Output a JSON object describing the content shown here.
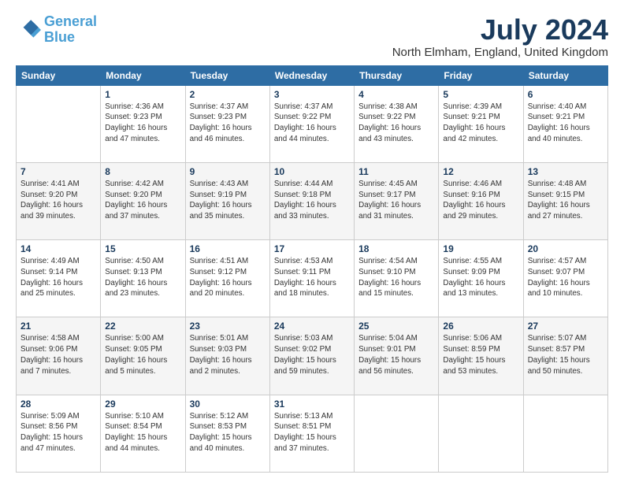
{
  "logo": {
    "line1": "General",
    "line2": "Blue"
  },
  "title": "July 2024",
  "subtitle": "North Elmham, England, United Kingdom",
  "headers": [
    "Sunday",
    "Monday",
    "Tuesday",
    "Wednesday",
    "Thursday",
    "Friday",
    "Saturday"
  ],
  "weeks": [
    [
      {
        "day": "",
        "info": ""
      },
      {
        "day": "1",
        "info": "Sunrise: 4:36 AM\nSunset: 9:23 PM\nDaylight: 16 hours\nand 47 minutes."
      },
      {
        "day": "2",
        "info": "Sunrise: 4:37 AM\nSunset: 9:23 PM\nDaylight: 16 hours\nand 46 minutes."
      },
      {
        "day": "3",
        "info": "Sunrise: 4:37 AM\nSunset: 9:22 PM\nDaylight: 16 hours\nand 44 minutes."
      },
      {
        "day": "4",
        "info": "Sunrise: 4:38 AM\nSunset: 9:22 PM\nDaylight: 16 hours\nand 43 minutes."
      },
      {
        "day": "5",
        "info": "Sunrise: 4:39 AM\nSunset: 9:21 PM\nDaylight: 16 hours\nand 42 minutes."
      },
      {
        "day": "6",
        "info": "Sunrise: 4:40 AM\nSunset: 9:21 PM\nDaylight: 16 hours\nand 40 minutes."
      }
    ],
    [
      {
        "day": "7",
        "info": "Sunrise: 4:41 AM\nSunset: 9:20 PM\nDaylight: 16 hours\nand 39 minutes."
      },
      {
        "day": "8",
        "info": "Sunrise: 4:42 AM\nSunset: 9:20 PM\nDaylight: 16 hours\nand 37 minutes."
      },
      {
        "day": "9",
        "info": "Sunrise: 4:43 AM\nSunset: 9:19 PM\nDaylight: 16 hours\nand 35 minutes."
      },
      {
        "day": "10",
        "info": "Sunrise: 4:44 AM\nSunset: 9:18 PM\nDaylight: 16 hours\nand 33 minutes."
      },
      {
        "day": "11",
        "info": "Sunrise: 4:45 AM\nSunset: 9:17 PM\nDaylight: 16 hours\nand 31 minutes."
      },
      {
        "day": "12",
        "info": "Sunrise: 4:46 AM\nSunset: 9:16 PM\nDaylight: 16 hours\nand 29 minutes."
      },
      {
        "day": "13",
        "info": "Sunrise: 4:48 AM\nSunset: 9:15 PM\nDaylight: 16 hours\nand 27 minutes."
      }
    ],
    [
      {
        "day": "14",
        "info": "Sunrise: 4:49 AM\nSunset: 9:14 PM\nDaylight: 16 hours\nand 25 minutes."
      },
      {
        "day": "15",
        "info": "Sunrise: 4:50 AM\nSunset: 9:13 PM\nDaylight: 16 hours\nand 23 minutes."
      },
      {
        "day": "16",
        "info": "Sunrise: 4:51 AM\nSunset: 9:12 PM\nDaylight: 16 hours\nand 20 minutes."
      },
      {
        "day": "17",
        "info": "Sunrise: 4:53 AM\nSunset: 9:11 PM\nDaylight: 16 hours\nand 18 minutes."
      },
      {
        "day": "18",
        "info": "Sunrise: 4:54 AM\nSunset: 9:10 PM\nDaylight: 16 hours\nand 15 minutes."
      },
      {
        "day": "19",
        "info": "Sunrise: 4:55 AM\nSunset: 9:09 PM\nDaylight: 16 hours\nand 13 minutes."
      },
      {
        "day": "20",
        "info": "Sunrise: 4:57 AM\nSunset: 9:07 PM\nDaylight: 16 hours\nand 10 minutes."
      }
    ],
    [
      {
        "day": "21",
        "info": "Sunrise: 4:58 AM\nSunset: 9:06 PM\nDaylight: 16 hours\nand 7 minutes."
      },
      {
        "day": "22",
        "info": "Sunrise: 5:00 AM\nSunset: 9:05 PM\nDaylight: 16 hours\nand 5 minutes."
      },
      {
        "day": "23",
        "info": "Sunrise: 5:01 AM\nSunset: 9:03 PM\nDaylight: 16 hours\nand 2 minutes."
      },
      {
        "day": "24",
        "info": "Sunrise: 5:03 AM\nSunset: 9:02 PM\nDaylight: 15 hours\nand 59 minutes."
      },
      {
        "day": "25",
        "info": "Sunrise: 5:04 AM\nSunset: 9:01 PM\nDaylight: 15 hours\nand 56 minutes."
      },
      {
        "day": "26",
        "info": "Sunrise: 5:06 AM\nSunset: 8:59 PM\nDaylight: 15 hours\nand 53 minutes."
      },
      {
        "day": "27",
        "info": "Sunrise: 5:07 AM\nSunset: 8:57 PM\nDaylight: 15 hours\nand 50 minutes."
      }
    ],
    [
      {
        "day": "28",
        "info": "Sunrise: 5:09 AM\nSunset: 8:56 PM\nDaylight: 15 hours\nand 47 minutes."
      },
      {
        "day": "29",
        "info": "Sunrise: 5:10 AM\nSunset: 8:54 PM\nDaylight: 15 hours\nand 44 minutes."
      },
      {
        "day": "30",
        "info": "Sunrise: 5:12 AM\nSunset: 8:53 PM\nDaylight: 15 hours\nand 40 minutes."
      },
      {
        "day": "31",
        "info": "Sunrise: 5:13 AM\nSunset: 8:51 PM\nDaylight: 15 hours\nand 37 minutes."
      },
      {
        "day": "",
        "info": ""
      },
      {
        "day": "",
        "info": ""
      },
      {
        "day": "",
        "info": ""
      }
    ]
  ]
}
